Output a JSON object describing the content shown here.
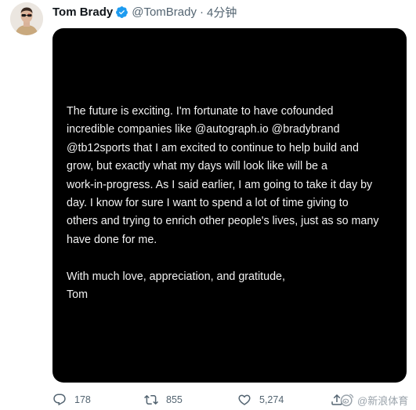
{
  "author": {
    "display_name": "Tom Brady",
    "handle": "@TomBrady",
    "separator": "·",
    "time": "4分钟",
    "verified": true
  },
  "statement": {
    "lines": [
      "The future is exciting.  I'm fortunate to have cofounded",
      "incredible companies like @autograph.io @bradybrand",
      "@tb12sports that I am excited to continue to help build and",
      "grow, but exactly what my days will look like will be a",
      "work-in-progress. As I said earlier, I am going to take it day by",
      "day.  I know for sure I want to spend a lot of time giving to",
      "others and trying to enrich other people's lives, just as so many",
      "have done for me."
    ],
    "closing_lines": [
      "With much love, appreciation, and gratitude,",
      "Tom"
    ]
  },
  "actions": {
    "reply_count": "178",
    "retweet_count": "855",
    "like_count": "5,274"
  },
  "watermark": {
    "text": "@新浪体育"
  },
  "icons": {
    "verified": "verified-badge-icon",
    "reply": "reply-icon",
    "retweet": "retweet-icon",
    "like": "heart-icon",
    "share": "share-icon",
    "watermark": "weibo-logo-icon"
  },
  "colors": {
    "verified_blue": "#1d9bf0",
    "secondary_text": "#536471",
    "media_background": "#000000",
    "statement_text": "#f2f2f2"
  }
}
